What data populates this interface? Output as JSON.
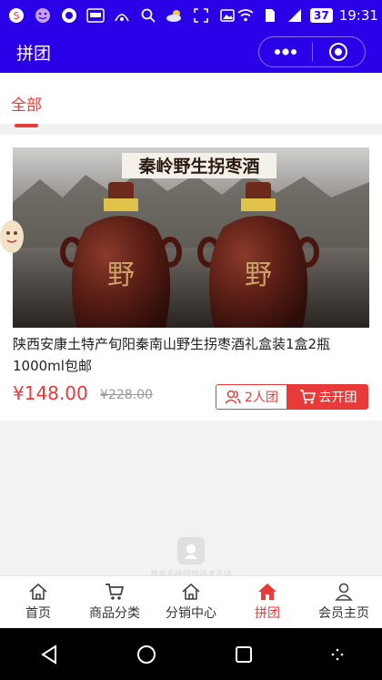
{
  "status_bar": {
    "battery": "37",
    "time": "19:31",
    "left_icons": [
      "sogou-icon",
      "emoji-icon",
      "qq-icon",
      "app-badge-icon",
      "signal-icon",
      "search-icon",
      "weather-icon",
      "screenshot-icon",
      "gallery-icon"
    ],
    "right_icons": [
      "wifi-icon",
      "sim-icon",
      "cellular-icon",
      "battery-icon"
    ]
  },
  "title_bar": {
    "title": "拼团",
    "capsule_icons": [
      "more-icon",
      "close-target-icon"
    ]
  },
  "tabs": [
    {
      "label": "全部",
      "active": true
    }
  ],
  "product": {
    "image_banner_text": "秦岭野生拐枣酒",
    "name": "陕西安康土特产旬阳秦南山野生拐枣酒礼盒装1盒2瓶1000ml包邮",
    "price": "¥148.00",
    "original_price": "¥228.00",
    "group_size_label": "2人团",
    "join_label": "去开团"
  },
  "watermark": {
    "text": "商务系统提供技术支持"
  },
  "tabbar": {
    "items": [
      {
        "label": "首页",
        "icon": "home-icon",
        "active": false
      },
      {
        "label": "商品分类",
        "icon": "cart-icon",
        "active": false
      },
      {
        "label": "分销中心",
        "icon": "home-icon",
        "active": false
      },
      {
        "label": "拼团",
        "icon": "home-filled-icon",
        "active": true
      },
      {
        "label": "会员主页",
        "icon": "user-icon",
        "active": false
      }
    ]
  },
  "colors": {
    "header": "#2a00e8",
    "accent": "#e93a3a"
  }
}
